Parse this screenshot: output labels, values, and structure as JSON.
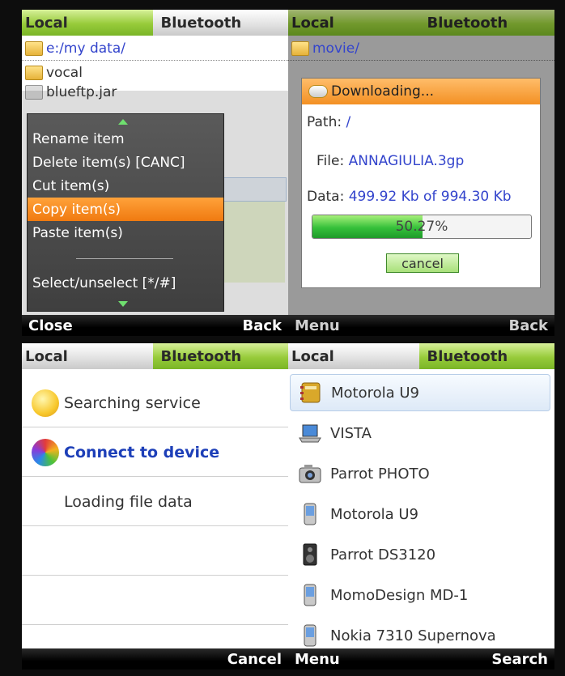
{
  "tabs": {
    "local": "Local",
    "bluetooth": "Bluetooth"
  },
  "screen1": {
    "path": "e:/my data/",
    "files": [
      "vocal",
      "blueftp.jar"
    ],
    "menu_items": [
      "Rename item",
      "Delete item(s) [CANC]",
      "Cut item(s)",
      "Copy item(s)",
      "Paste item(s)",
      "Select/unselect [*/#]"
    ],
    "selected_menu_item": "Copy item(s)",
    "softkeys": {
      "left": "Close",
      "right": "Back"
    }
  },
  "screen2": {
    "path": "movie/",
    "dialog": {
      "title": "Downloading...",
      "path_label": "Path:",
      "path_value": "/",
      "file_label": "File:",
      "file_value": "ANNAGIULIA.3gp",
      "data_label": "Data:",
      "data_value": "499.92 Kb of 994.30 Kb",
      "progress_percent": 50.27,
      "progress_text": "50.27%",
      "cancel_label": "cancel"
    },
    "softkeys": {
      "left": "Menu",
      "right": "Back"
    }
  },
  "screen3": {
    "items": [
      "Searching service",
      "Connect to device",
      "Loading file data"
    ],
    "softkeys": {
      "left": "",
      "right": "Cancel"
    }
  },
  "screen4": {
    "devices": [
      {
        "name": "Motorola U9",
        "icon": "address-book-icon"
      },
      {
        "name": "VISTA",
        "icon": "laptop-icon"
      },
      {
        "name": "Parrot PHOTO",
        "icon": "camera-icon"
      },
      {
        "name": "Motorola U9",
        "icon": "phone-icon"
      },
      {
        "name": "Parrot DS3120",
        "icon": "speaker-icon"
      },
      {
        "name": "MomoDesign MD-1",
        "icon": "phone-icon"
      },
      {
        "name": "Nokia 7310 Supernova",
        "icon": "phone-icon"
      }
    ],
    "softkeys": {
      "left": "Menu",
      "right": "Search"
    }
  },
  "colors": {
    "tab_green": "#97cb3a",
    "tab_grey": "#e3e3e3",
    "highlight_orange": "#f07a10",
    "link_blue": "#3344cc",
    "progress_green": "#35c03a"
  }
}
